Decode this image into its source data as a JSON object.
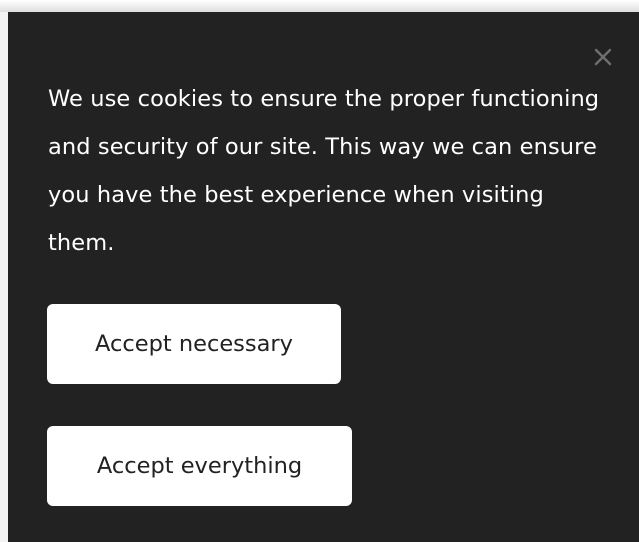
{
  "banner": {
    "message": "We use cookies to ensure the proper functioning and security of our site. This way we can ensure you have the best experience when visiting them.",
    "close_icon": "close-icon",
    "buttons": {
      "accept_necessary": "Accept necessary",
      "accept_everything": "Accept everything"
    }
  },
  "colors": {
    "banner_background": "#222222",
    "text": "#ffffff",
    "button_background": "#ffffff",
    "button_text": "#222222",
    "close_icon": "#6f6f6f"
  }
}
